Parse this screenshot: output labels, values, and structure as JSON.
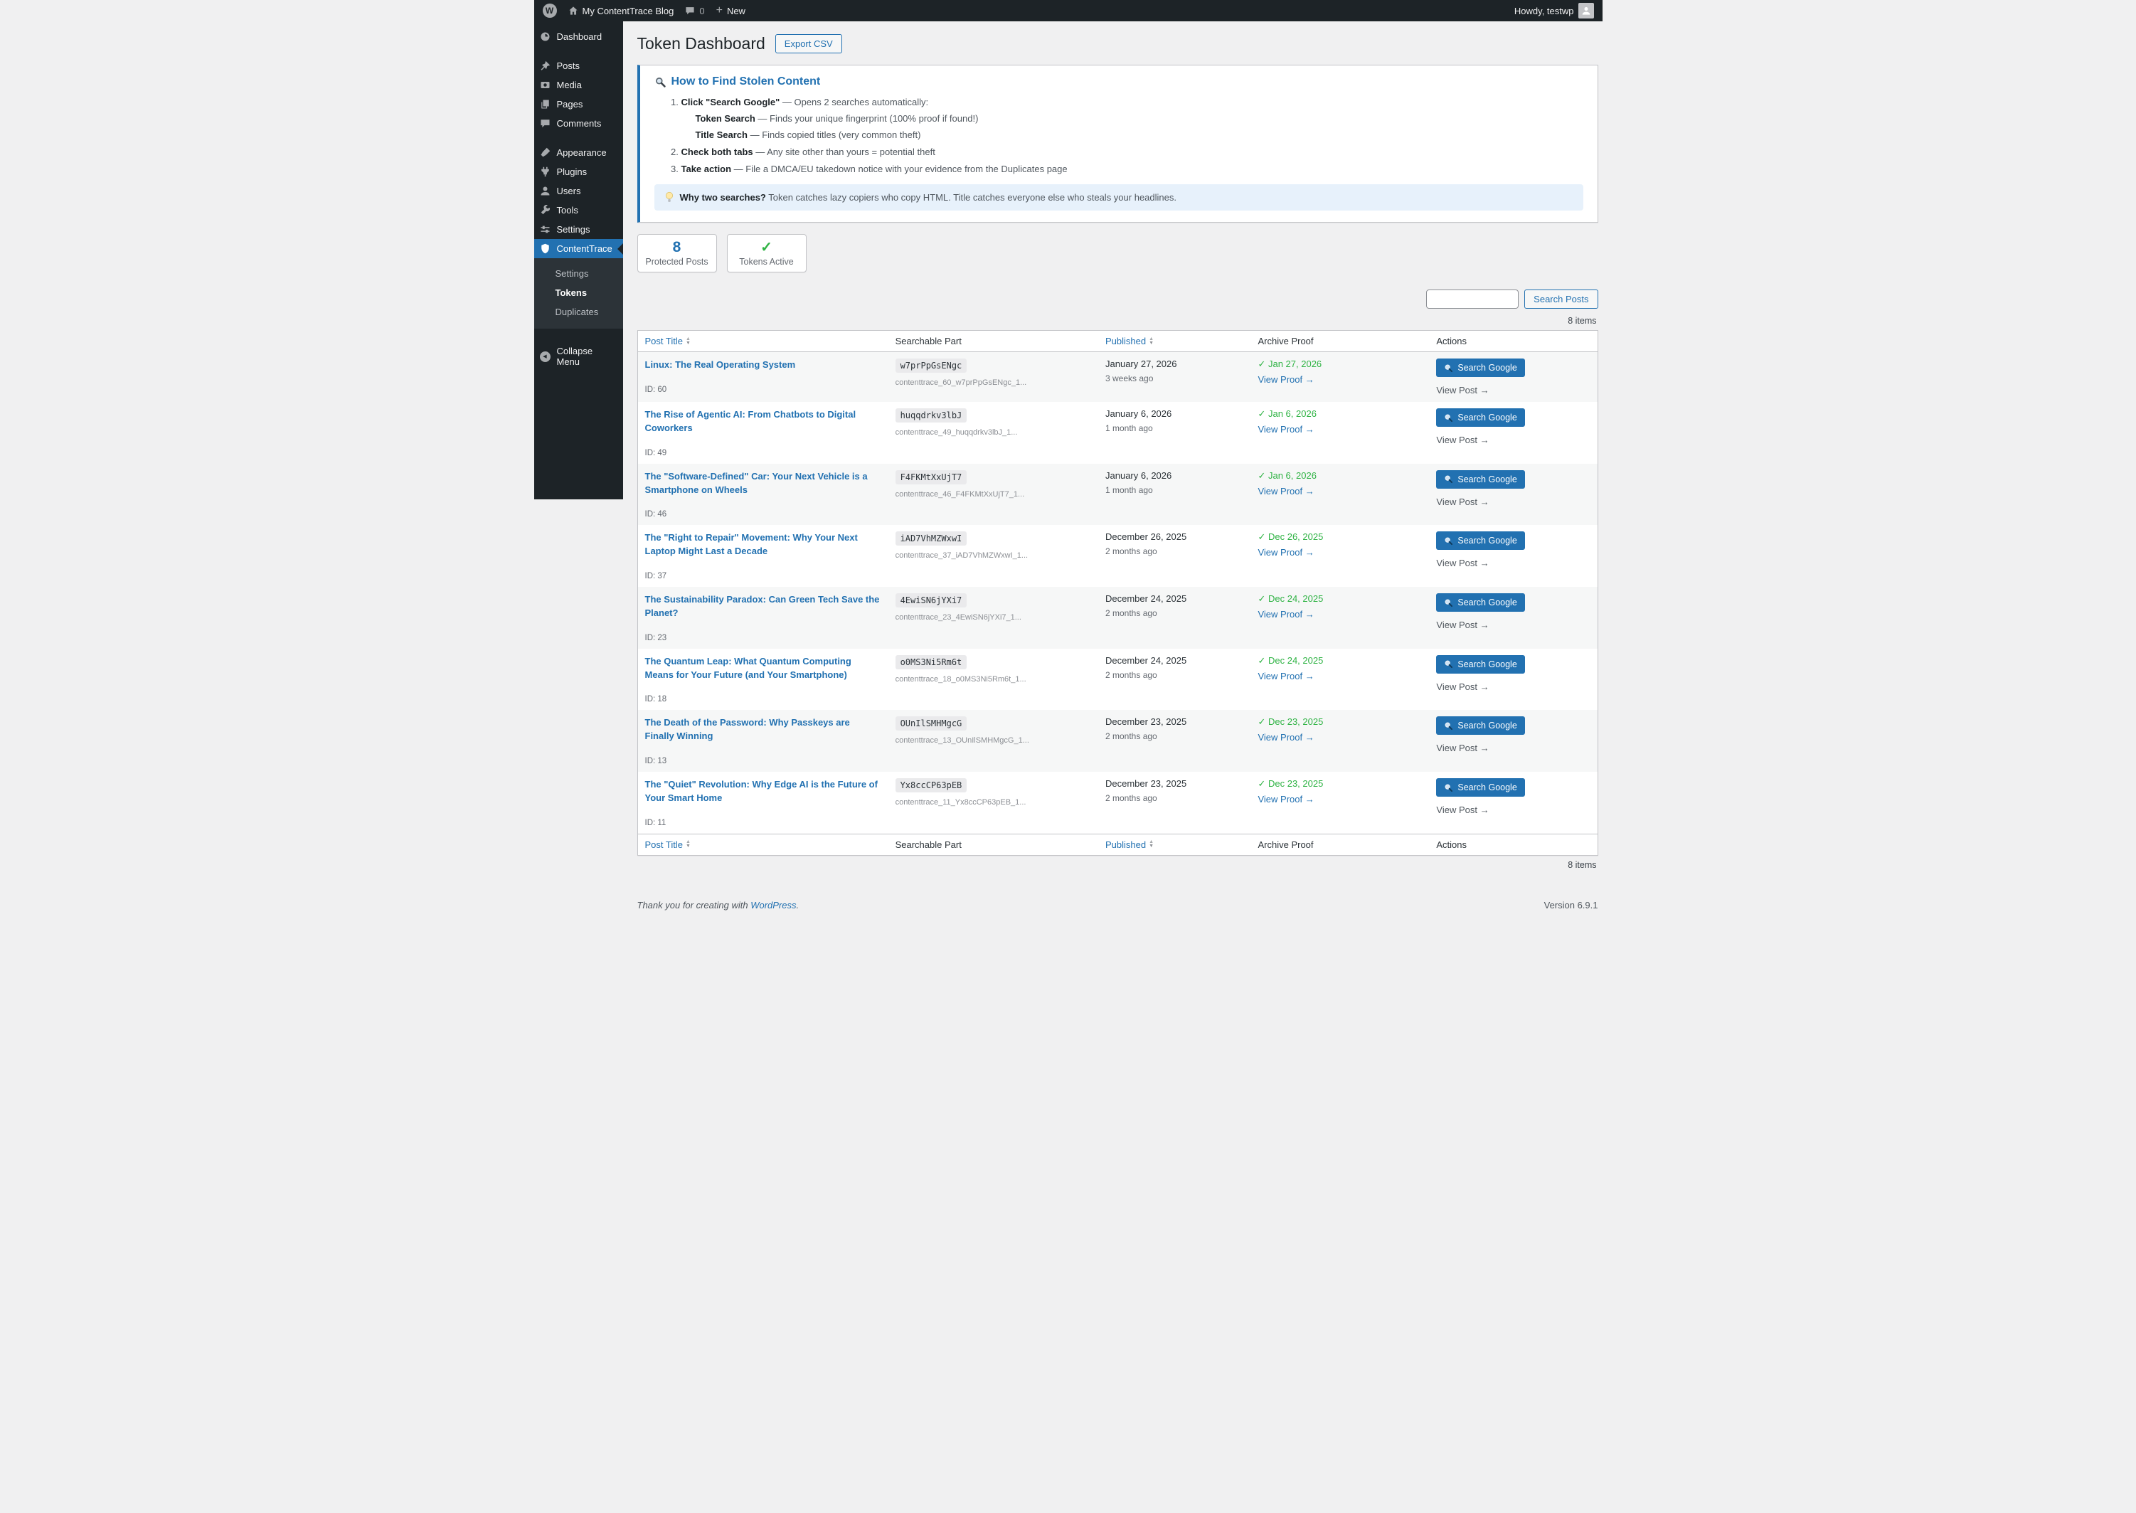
{
  "admin_bar": {
    "site_name": "My ContentTrace Blog",
    "comments_count": "0",
    "new_label": "New",
    "howdy": "Howdy, testwp"
  },
  "sidebar": {
    "items": [
      {
        "label": "Dashboard",
        "icon": "dashboard-icon"
      },
      {
        "label": "Posts",
        "icon": "posts-icon",
        "gap_before": true
      },
      {
        "label": "Media",
        "icon": "media-icon"
      },
      {
        "label": "Pages",
        "icon": "pages-icon"
      },
      {
        "label": "Comments",
        "icon": "comments-icon"
      },
      {
        "label": "Appearance",
        "icon": "appearance-icon",
        "gap_before": true
      },
      {
        "label": "Plugins",
        "icon": "plugins-icon"
      },
      {
        "label": "Users",
        "icon": "users-icon"
      },
      {
        "label": "Tools",
        "icon": "tools-icon"
      },
      {
        "label": "Settings",
        "icon": "settings-icon"
      },
      {
        "label": "ContentTrace",
        "icon": "shield-icon",
        "active": true
      }
    ],
    "submenu": [
      {
        "label": "Settings"
      },
      {
        "label": "Tokens",
        "current": true
      },
      {
        "label": "Duplicates"
      }
    ],
    "collapse_label": "Collapse Menu"
  },
  "page": {
    "title": "Token Dashboard",
    "export_button": "Export CSV"
  },
  "howto": {
    "heading": "How to Find Stolen Content",
    "steps": [
      {
        "bold": "Click \"Search Google\"",
        "text": " — Opens 2 searches automatically:"
      },
      {
        "bold": "Check both tabs",
        "text": " — Any site other than yours = potential theft"
      },
      {
        "bold": "Take action",
        "text": " — File a DMCA/EU takedown notice with your evidence from the Duplicates page"
      }
    ],
    "sub_steps": [
      {
        "bold": "Token Search",
        "text": " — Finds your unique fingerprint (100% proof if found!)"
      },
      {
        "bold": "Title Search",
        "text": " — Finds copied titles (very common theft)"
      }
    ],
    "tip_bold": "Why two searches?",
    "tip_text": " Token catches lazy copiers who copy HTML. Title catches everyone else who steals your headlines."
  },
  "stats": {
    "protected_count": "8",
    "protected_label": "Protected Posts",
    "tokens_check": "✓",
    "tokens_label": "Tokens Active"
  },
  "search": {
    "button_label": "Search Posts",
    "items_count": "8 items"
  },
  "table": {
    "columns": {
      "title": "Post Title",
      "searchable": "Searchable Part",
      "published": "Published",
      "archive": "Archive Proof",
      "actions": "Actions"
    },
    "search_google_label": "Search Google",
    "view_proof_label": "View Proof →",
    "view_post_label": "View Post →",
    "rows": [
      {
        "title": "Linux: The Real Operating System",
        "token": "w7prPpGsENgc",
        "slug": "contenttrace_60_w7prPpGsENgc_1...",
        "published_date": "January 27, 2026",
        "published_ago": "3 weeks ago",
        "archive": "✓ Jan 27, 2026",
        "id": "ID: 60"
      },
      {
        "title": "The Rise of Agentic AI: From Chatbots to Digital Coworkers",
        "token": "huqqdrkv3lbJ",
        "slug": "contenttrace_49_huqqdrkv3lbJ_1...",
        "published_date": "January 6, 2026",
        "published_ago": "1 month ago",
        "archive": "✓ Jan 6, 2026",
        "id": "ID: 49"
      },
      {
        "title": "The \"Software-Defined\" Car: Your Next Vehicle is a Smartphone on Wheels",
        "token": "F4FKMtXxUjT7",
        "slug": "contenttrace_46_F4FKMtXxUjT7_1...",
        "published_date": "January 6, 2026",
        "published_ago": "1 month ago",
        "archive": "✓ Jan 6, 2026",
        "id": "ID: 46"
      },
      {
        "title": "The \"Right to Repair\" Movement: Why Your Next Laptop Might Last a Decade",
        "token": "iAD7VhMZWxwI",
        "slug": "contenttrace_37_iAD7VhMZWxwI_1...",
        "published_date": "December 26, 2025",
        "published_ago": "2 months ago",
        "archive": "✓ Dec 26, 2025",
        "id": "ID: 37"
      },
      {
        "title": "The Sustainability Paradox: Can Green Tech Save the Planet?",
        "token": "4EwiSN6jYXi7",
        "slug": "contenttrace_23_4EwiSN6jYXi7_1...",
        "published_date": "December 24, 2025",
        "published_ago": "2 months ago",
        "archive": "✓ Dec 24, 2025",
        "id": "ID: 23"
      },
      {
        "title": "The Quantum Leap: What Quantum Computing Means for Your Future (and Your Smartphone)",
        "token": "o0MS3Ni5Rm6t",
        "slug": "contenttrace_18_o0MS3Ni5Rm6t_1...",
        "published_date": "December 24, 2025",
        "published_ago": "2 months ago",
        "archive": "✓ Dec 24, 2025",
        "id": "ID: 18"
      },
      {
        "title": "The Death of the Password: Why Passkeys are Finally Winning",
        "token": "OUnIlSMHMgcG",
        "slug": "contenttrace_13_OUnIlSMHMgcG_1...",
        "published_date": "December 23, 2025",
        "published_ago": "2 months ago",
        "archive": "✓ Dec 23, 2025",
        "id": "ID: 13"
      },
      {
        "title": "The \"Quiet\" Revolution: Why Edge AI is the Future of Your Smart Home",
        "token": "Yx8ccCP63pEB",
        "slug": "contenttrace_11_Yx8ccCP63pEB_1...",
        "published_date": "December 23, 2025",
        "published_ago": "2 months ago",
        "archive": "✓ Dec 23, 2025",
        "id": "ID: 11"
      }
    ]
  },
  "footer": {
    "thanks_text": "Thank you for creating with ",
    "wordpress_link": "WordPress",
    "thanks_period": ".",
    "version": "Version 6.9.1"
  },
  "colors": {
    "accent_blue": "#2271b1",
    "success_green": "#2fb344",
    "menu_bg": "#1d2327",
    "body_bg": "#f0f0f1"
  }
}
